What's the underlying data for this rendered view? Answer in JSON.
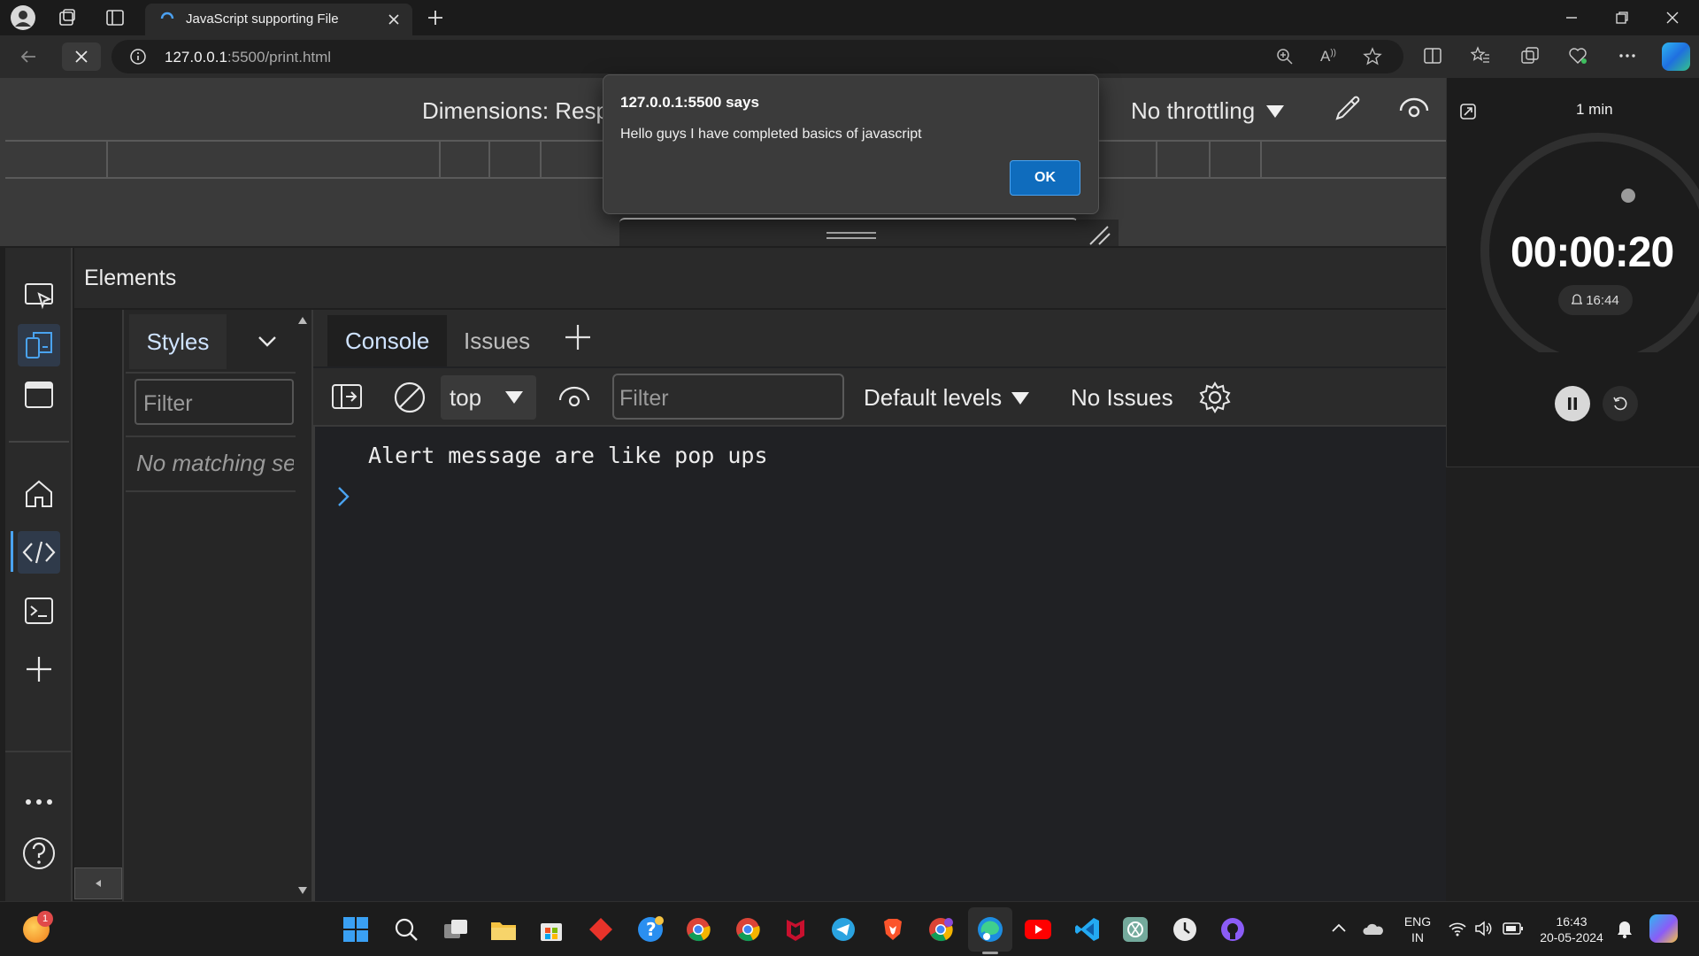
{
  "browser": {
    "tab_title": "JavaScript supporting File",
    "url_host": "127.0.0.1",
    "url_rest": ":5500/print.html"
  },
  "device_toolbar": {
    "dimensions_label": "Dimensions: Resp",
    "throttling_label": "No throttling"
  },
  "alert": {
    "title": "127.0.0.1:5500 says",
    "message": "Hello guys I have completed basics of javascript",
    "ok_label": "OK"
  },
  "devtools": {
    "elements_label": "Elements",
    "styles_tab": "Styles",
    "styles_filter_placeholder": "Filter",
    "no_matching": "No matching se",
    "console_tabs": [
      "Console",
      "Issues"
    ],
    "context": "top",
    "console_filter_placeholder": "Filter",
    "levels": "Default levels",
    "issues": "No Issues",
    "log_message": "Alert message are like pop ups",
    "icons": [
      "inspect-icon",
      "device-toggle-icon",
      "panel-icon",
      "home-icon",
      "code-icon",
      "terminal-icon",
      "plus-icon",
      "more-icon",
      "help-icon"
    ]
  },
  "clock_widget": {
    "duration_label": "1 min",
    "time": "00:00:20",
    "alarm": "16:44",
    "progress": 0.33
  },
  "taskbar": {
    "notification_count": "1",
    "lang_top": "ENG",
    "lang_bottom": "IN",
    "time": "16:43",
    "date": "20-05-2024",
    "accent": "#0f6cbd"
  }
}
